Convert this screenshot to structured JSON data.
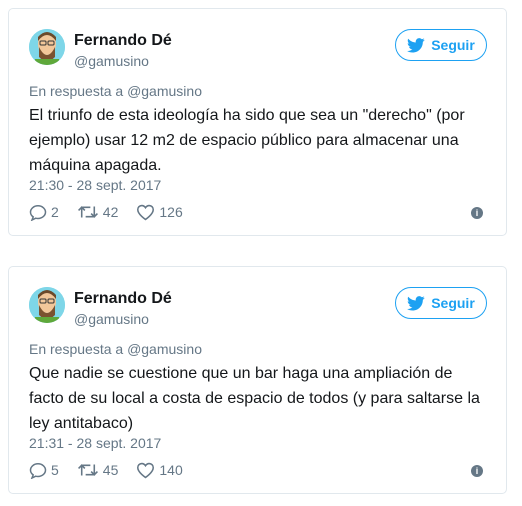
{
  "colors": {
    "accent": "#1da1f2",
    "secondary_text": "#657786",
    "border": "#e1e8ed"
  },
  "tweets": [
    {
      "name": "Fernando Dé",
      "handle": "@gamusino",
      "follow_label": "Seguir",
      "reply_prefix": "En respuesta a",
      "reply_handle": "@gamusino",
      "text": "El triunfo de esta ideología ha sido que sea un \"derecho\" (por ejemplo) usar 12 m2 de espacio público para almacenar una máquina apagada.",
      "timestamp": "21:30 - 28 sept. 2017",
      "replies": "2",
      "retweets": "42",
      "likes": "126",
      "icons": [
        "avatar",
        "bird-icon",
        "reply-icon",
        "retweet-icon",
        "heart-icon",
        "info-icon"
      ]
    },
    {
      "name": "Fernando Dé",
      "handle": "@gamusino",
      "follow_label": "Seguir",
      "reply_prefix": "En respuesta a",
      "reply_handle": "@gamusino",
      "text": "Que nadie se cuestione que un bar haga una ampliación de facto de su local a costa de espacio de todos (y para saltarse la ley antitabaco)",
      "timestamp": "21:31 - 28 sept. 2017",
      "replies": "5",
      "retweets": "45",
      "likes": "140",
      "icons": [
        "avatar",
        "bird-icon",
        "reply-icon",
        "retweet-icon",
        "heart-icon",
        "info-icon"
      ]
    }
  ]
}
